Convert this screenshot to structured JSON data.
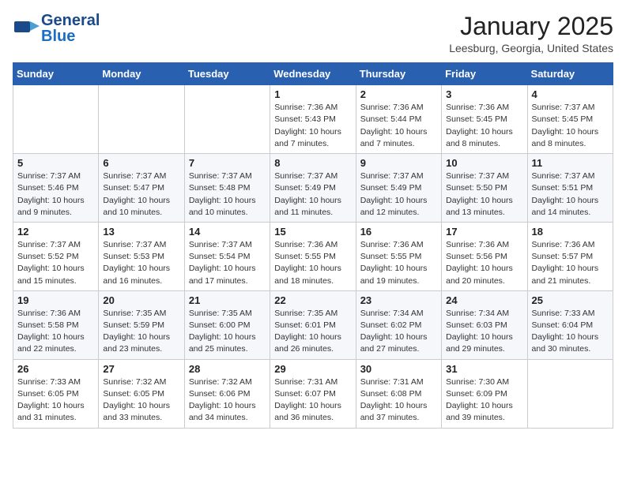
{
  "header": {
    "logo_general": "General",
    "logo_blue": "Blue",
    "month_title": "January 2025",
    "location": "Leesburg, Georgia, United States"
  },
  "weekdays": [
    "Sunday",
    "Monday",
    "Tuesday",
    "Wednesday",
    "Thursday",
    "Friday",
    "Saturday"
  ],
  "weeks": [
    [
      {
        "day": "",
        "info": ""
      },
      {
        "day": "",
        "info": ""
      },
      {
        "day": "",
        "info": ""
      },
      {
        "day": "1",
        "info": "Sunrise: 7:36 AM\nSunset: 5:43 PM\nDaylight: 10 hours\nand 7 minutes."
      },
      {
        "day": "2",
        "info": "Sunrise: 7:36 AM\nSunset: 5:44 PM\nDaylight: 10 hours\nand 7 minutes."
      },
      {
        "day": "3",
        "info": "Sunrise: 7:36 AM\nSunset: 5:45 PM\nDaylight: 10 hours\nand 8 minutes."
      },
      {
        "day": "4",
        "info": "Sunrise: 7:37 AM\nSunset: 5:45 PM\nDaylight: 10 hours\nand 8 minutes."
      }
    ],
    [
      {
        "day": "5",
        "info": "Sunrise: 7:37 AM\nSunset: 5:46 PM\nDaylight: 10 hours\nand 9 minutes."
      },
      {
        "day": "6",
        "info": "Sunrise: 7:37 AM\nSunset: 5:47 PM\nDaylight: 10 hours\nand 10 minutes."
      },
      {
        "day": "7",
        "info": "Sunrise: 7:37 AM\nSunset: 5:48 PM\nDaylight: 10 hours\nand 10 minutes."
      },
      {
        "day": "8",
        "info": "Sunrise: 7:37 AM\nSunset: 5:49 PM\nDaylight: 10 hours\nand 11 minutes."
      },
      {
        "day": "9",
        "info": "Sunrise: 7:37 AM\nSunset: 5:49 PM\nDaylight: 10 hours\nand 12 minutes."
      },
      {
        "day": "10",
        "info": "Sunrise: 7:37 AM\nSunset: 5:50 PM\nDaylight: 10 hours\nand 13 minutes."
      },
      {
        "day": "11",
        "info": "Sunrise: 7:37 AM\nSunset: 5:51 PM\nDaylight: 10 hours\nand 14 minutes."
      }
    ],
    [
      {
        "day": "12",
        "info": "Sunrise: 7:37 AM\nSunset: 5:52 PM\nDaylight: 10 hours\nand 15 minutes."
      },
      {
        "day": "13",
        "info": "Sunrise: 7:37 AM\nSunset: 5:53 PM\nDaylight: 10 hours\nand 16 minutes."
      },
      {
        "day": "14",
        "info": "Sunrise: 7:37 AM\nSunset: 5:54 PM\nDaylight: 10 hours\nand 17 minutes."
      },
      {
        "day": "15",
        "info": "Sunrise: 7:36 AM\nSunset: 5:55 PM\nDaylight: 10 hours\nand 18 minutes."
      },
      {
        "day": "16",
        "info": "Sunrise: 7:36 AM\nSunset: 5:55 PM\nDaylight: 10 hours\nand 19 minutes."
      },
      {
        "day": "17",
        "info": "Sunrise: 7:36 AM\nSunset: 5:56 PM\nDaylight: 10 hours\nand 20 minutes."
      },
      {
        "day": "18",
        "info": "Sunrise: 7:36 AM\nSunset: 5:57 PM\nDaylight: 10 hours\nand 21 minutes."
      }
    ],
    [
      {
        "day": "19",
        "info": "Sunrise: 7:36 AM\nSunset: 5:58 PM\nDaylight: 10 hours\nand 22 minutes."
      },
      {
        "day": "20",
        "info": "Sunrise: 7:35 AM\nSunset: 5:59 PM\nDaylight: 10 hours\nand 23 minutes."
      },
      {
        "day": "21",
        "info": "Sunrise: 7:35 AM\nSunset: 6:00 PM\nDaylight: 10 hours\nand 25 minutes."
      },
      {
        "day": "22",
        "info": "Sunrise: 7:35 AM\nSunset: 6:01 PM\nDaylight: 10 hours\nand 26 minutes."
      },
      {
        "day": "23",
        "info": "Sunrise: 7:34 AM\nSunset: 6:02 PM\nDaylight: 10 hours\nand 27 minutes."
      },
      {
        "day": "24",
        "info": "Sunrise: 7:34 AM\nSunset: 6:03 PM\nDaylight: 10 hours\nand 29 minutes."
      },
      {
        "day": "25",
        "info": "Sunrise: 7:33 AM\nSunset: 6:04 PM\nDaylight: 10 hours\nand 30 minutes."
      }
    ],
    [
      {
        "day": "26",
        "info": "Sunrise: 7:33 AM\nSunset: 6:05 PM\nDaylight: 10 hours\nand 31 minutes."
      },
      {
        "day": "27",
        "info": "Sunrise: 7:32 AM\nSunset: 6:05 PM\nDaylight: 10 hours\nand 33 minutes."
      },
      {
        "day": "28",
        "info": "Sunrise: 7:32 AM\nSunset: 6:06 PM\nDaylight: 10 hours\nand 34 minutes."
      },
      {
        "day": "29",
        "info": "Sunrise: 7:31 AM\nSunset: 6:07 PM\nDaylight: 10 hours\nand 36 minutes."
      },
      {
        "day": "30",
        "info": "Sunrise: 7:31 AM\nSunset: 6:08 PM\nDaylight: 10 hours\nand 37 minutes."
      },
      {
        "day": "31",
        "info": "Sunrise: 7:30 AM\nSunset: 6:09 PM\nDaylight: 10 hours\nand 39 minutes."
      },
      {
        "day": "",
        "info": ""
      }
    ]
  ]
}
